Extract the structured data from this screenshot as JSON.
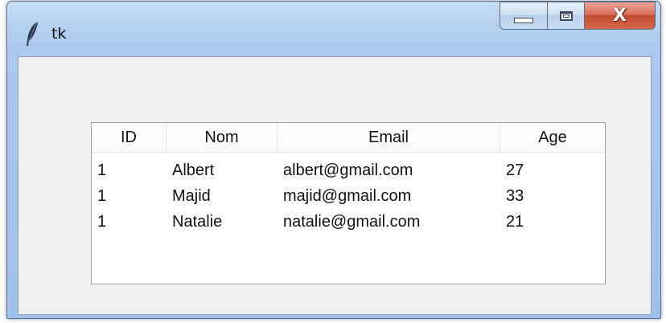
{
  "window": {
    "title": "tk"
  },
  "caption_buttons": {
    "minimize_icon": "minimize-icon",
    "maximize_icon": "maximize-icon",
    "close_label": "X"
  },
  "treeview": {
    "columns": [
      "ID",
      "Nom",
      "Email",
      "Age"
    ],
    "rows": [
      [
        "1",
        "Albert",
        "albert@gmail.com",
        "27"
      ],
      [
        "1",
        "Majid",
        "majid@gmail.com",
        "33"
      ],
      [
        "1",
        "Natalie",
        "natalie@gmail.com",
        "21"
      ]
    ]
  },
  "colors": {
    "close_button": "#c44b31",
    "titlebar": "#b7d2f0",
    "client_bg": "#f0f0f0"
  }
}
